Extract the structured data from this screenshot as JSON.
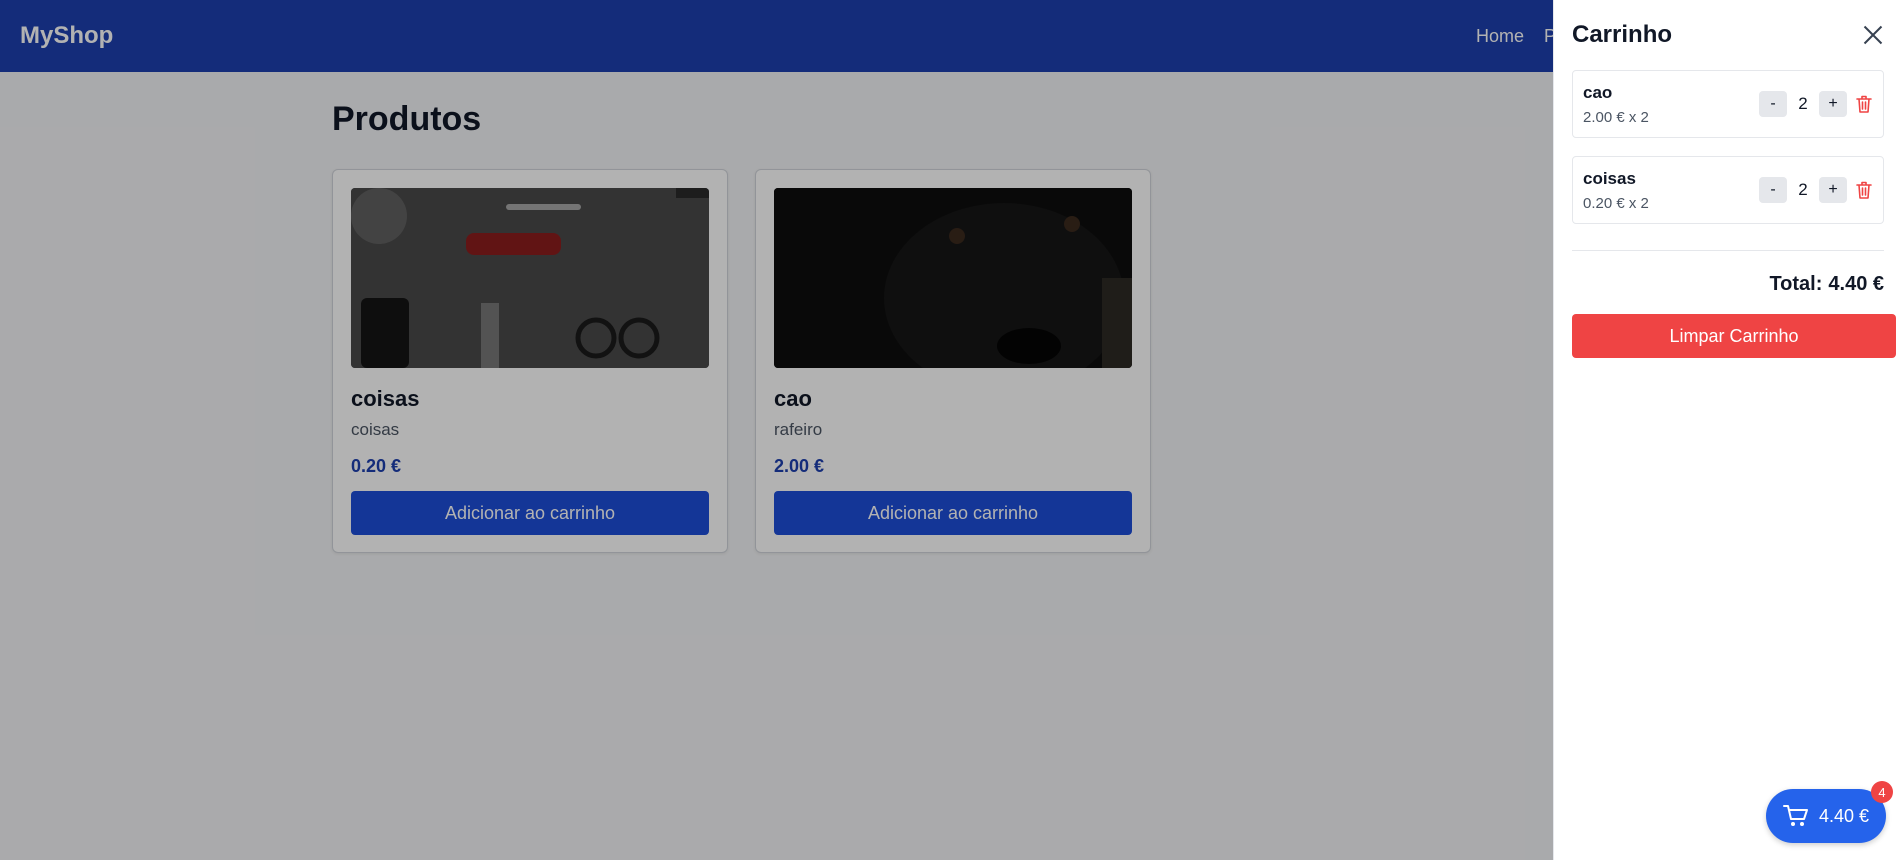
{
  "header": {
    "brand": "MyShop",
    "nav": [
      {
        "label": "Home"
      },
      {
        "label": "P"
      }
    ]
  },
  "main": {
    "title": "Produtos",
    "products": [
      {
        "name": "coisas",
        "description": "coisas",
        "price": "0.20 €",
        "button_label": "Adicionar ao carrinho"
      },
      {
        "name": "cao",
        "description": "rafeiro",
        "price": "2.00 €",
        "button_label": "Adicionar ao carrinho"
      }
    ]
  },
  "cart": {
    "title": "Carrinho",
    "items": [
      {
        "name": "cao",
        "detail": "2.00 € x 2",
        "quantity": "2",
        "minus": "-",
        "plus": "+"
      },
      {
        "name": "coisas",
        "detail": "0.20 € x 2",
        "quantity": "2",
        "minus": "-",
        "plus": "+"
      }
    ],
    "total_label": "Total:",
    "total_value": "4.40 €",
    "clear_label": "Limpar Carrinho"
  },
  "floating_cart": {
    "amount": "4.40 €",
    "badge": "4"
  },
  "colors": {
    "header_bg": "#1e40af",
    "primary_button": "#1d4ed8",
    "danger": "#ef4444",
    "price_text": "#1e40af"
  },
  "icons": [
    "close-icon",
    "trash-icon",
    "cart-icon"
  ]
}
